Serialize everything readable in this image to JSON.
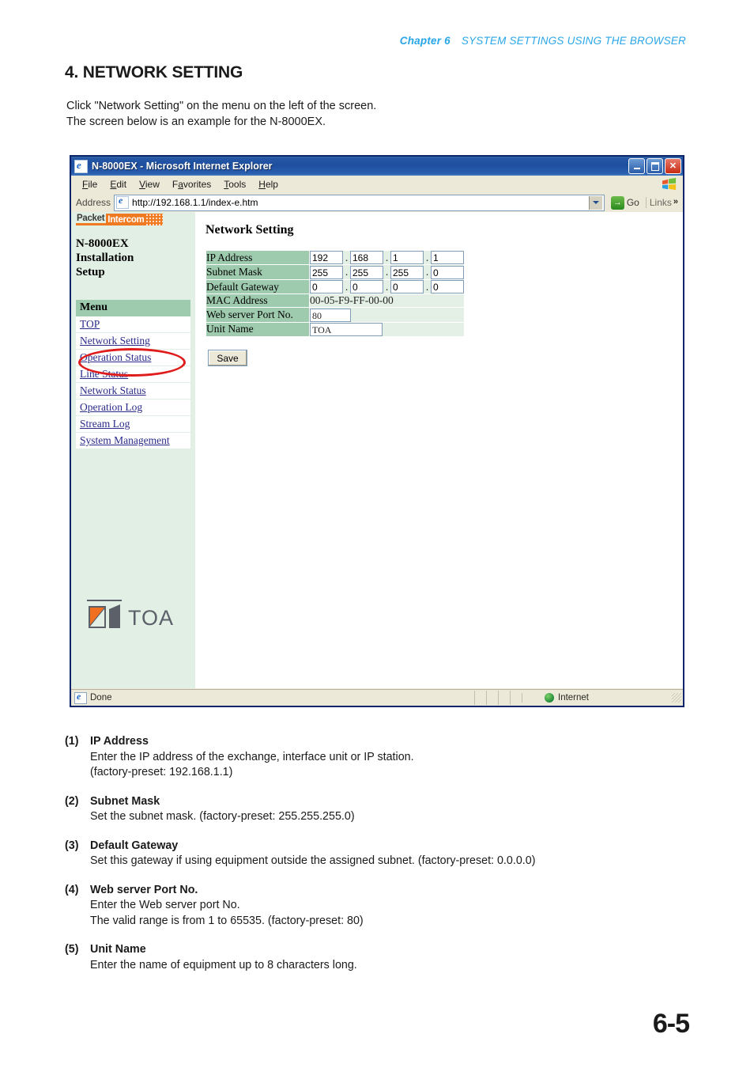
{
  "page": {
    "chapter_number": "Chapter 6",
    "chapter_title": "SYSTEM SETTINGS USING THE BROWSER",
    "section_title": "4. NETWORK SETTING",
    "intro_line1": "Click \"Network Setting\" on the menu on the left of the screen.",
    "intro_line2": "The screen below is an example for the N-8000EX.",
    "folio": "6-5",
    "accent_blue": "#2aa6e8"
  },
  "browser": {
    "title": "N-8000EX - Microsoft Internet Explorer",
    "minimize_label": "",
    "maximize_label": "",
    "close_label": "✕",
    "menu": [
      "File",
      "Edit",
      "View",
      "Favorites",
      "Tools",
      "Help"
    ],
    "address_label": "Address",
    "address_value": "http://192.168.1.1/index-e.htm",
    "go_label": "Go",
    "go_glyph": "→",
    "links_label": "Links",
    "links_chevron": "»",
    "status_text": "Done",
    "status_zone": "Internet"
  },
  "sidebar": {
    "brand_packet": "Packet",
    "brand_intercom": "Intercom",
    "panel_title_line1": "N-8000EX",
    "panel_title_line2": "Installation",
    "panel_title_line3": "Setup",
    "menu_header": "Menu",
    "items": [
      {
        "label": "TOP"
      },
      {
        "label": "Network Setting"
      },
      {
        "label": "Operation Status"
      },
      {
        "label": "Line Status"
      },
      {
        "label": "Network Status"
      },
      {
        "label": "Operation Log"
      },
      {
        "label": "Stream Log"
      },
      {
        "label": "System Management"
      }
    ],
    "logo_text": "TOA",
    "brand_orange": "#f07a22",
    "panel_bg": "#e2efe5"
  },
  "form": {
    "title": "Network Setting",
    "rows": {
      "ip_address": {
        "label": "IP Address",
        "octets": [
          "192",
          "168",
          "1",
          "1"
        ]
      },
      "subnet_mask": {
        "label": "Subnet Mask",
        "octets": [
          "255",
          "255",
          "255",
          "0"
        ]
      },
      "default_gateway": {
        "label": "Default Gateway",
        "octets": [
          "0",
          "0",
          "0",
          "0"
        ]
      },
      "mac_address": {
        "label": "MAC Address",
        "value": "00-05-F9-FF-00-00"
      },
      "web_port": {
        "label": "Web server Port No.",
        "value": "80"
      },
      "unit_name": {
        "label": "Unit Name",
        "value": "TOA"
      }
    },
    "save_label": "Save",
    "label_cell_color": "#9ecaae",
    "value_cell_color": "#e4f0e6"
  },
  "annotation": {
    "ellipse_target": "Network Setting",
    "color": "#e01b1b"
  },
  "notes": [
    {
      "num": "(1)",
      "heading": "IP Address",
      "lines": [
        "Enter the IP address of the exchange, interface unit or IP station.",
        " (factory-preset: 192.168.1.1)"
      ]
    },
    {
      "num": "(2)",
      "heading": "Subnet Mask",
      "lines": [
        "Set the subnet mask. (factory-preset: 255.255.255.0)"
      ]
    },
    {
      "num": "(3)",
      "heading": "Default Gateway",
      "lines": [
        "Set this gateway if using equipment outside the assigned subnet. (factory-preset: 0.0.0.0)"
      ]
    },
    {
      "num": "(4)",
      "heading": "Web server Port No.",
      "lines": [
        "Enter the Web server port No.",
        "The valid range is from 1 to 65535. (factory-preset: 80)"
      ]
    },
    {
      "num": "(5)",
      "heading": "Unit Name",
      "lines": [
        "Enter the name of equipment up to 8 characters long."
      ]
    }
  ]
}
